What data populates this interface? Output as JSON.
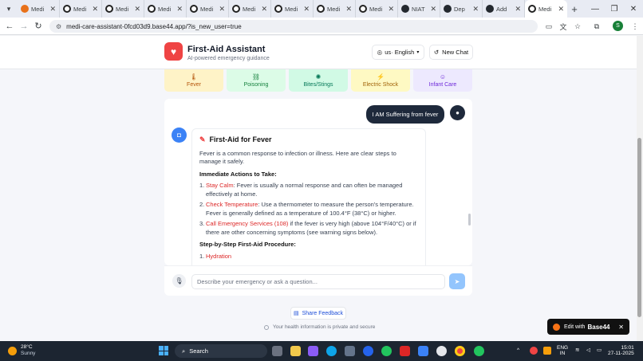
{
  "browser": {
    "tabs": [
      {
        "label": "Medi",
        "icon": "red",
        "active": false
      },
      {
        "label": "Medi",
        "icon": "white",
        "active": false
      },
      {
        "label": "Medi",
        "icon": "white",
        "active": false
      },
      {
        "label": "Medi",
        "icon": "white",
        "active": false
      },
      {
        "label": "Medi",
        "icon": "white",
        "active": false
      },
      {
        "label": "Medi",
        "icon": "white",
        "active": false
      },
      {
        "label": "Medi",
        "icon": "white",
        "active": false
      },
      {
        "label": "Medi",
        "icon": "white",
        "active": false
      },
      {
        "label": "Medi",
        "icon": "white",
        "active": false
      },
      {
        "label": "NIAT",
        "icon": "github",
        "active": false
      },
      {
        "label": "Dep",
        "icon": "github",
        "active": false
      },
      {
        "label": "Add",
        "icon": "github",
        "active": false
      },
      {
        "label": "Medi",
        "icon": "white",
        "active": true
      }
    ],
    "url": "medi-care-assistant-0fcd03d9.base44.app/?is_new_user=true",
    "profile_initial": "S"
  },
  "app": {
    "title": "First-Aid Assistant",
    "subtitle": "AI-powered emergency guidance",
    "language": "us· English",
    "new_chat": "New Chat",
    "accent": "#ef4444"
  },
  "categories": [
    {
      "label": "Fever",
      "icon": "thermometer-icon",
      "bg": "#fef3c7",
      "fg": "#b45309"
    },
    {
      "label": "Poisoning",
      "icon": "link-icon",
      "bg": "#dcfce7",
      "fg": "#15803d"
    },
    {
      "label": "Bites/Stings",
      "icon": "bug-icon",
      "bg": "#d1fae5",
      "fg": "#047857"
    },
    {
      "label": "Electric Shock",
      "icon": "bolt-icon",
      "bg": "#fef9c3",
      "fg": "#a16207"
    },
    {
      "label": "Infant Care",
      "icon": "baby-icon",
      "bg": "#ede9fe",
      "fg": "#6d28d9"
    }
  ],
  "chat": {
    "user_message": "I AM Suffering from fever",
    "bot": {
      "title": "First-Aid for Fever",
      "intro": "Fever is a common response to infection or illness. Here are clear steps to manage it safely.",
      "immediate_heading": "Immediate Actions to Take:",
      "immediate": [
        {
          "n": "1.",
          "key": "Stay Calm",
          "text": ": Fever is usually a normal response and can often be managed effectively at home."
        },
        {
          "n": "2.",
          "key": "Check Temperature",
          "text": ": Use a thermometer to measure the person's temperature. Fever is generally defined as a temperature of 100.4°F (38°C) or higher."
        },
        {
          "n": "3.",
          "key": "Call Emergency Services (108)",
          "text": " if the fever is very high (above 104°F/40°C) or if there are other concerning symptoms (see warning signs below)."
        }
      ],
      "procedure_heading": "Step-by-Step First-Aid Procedure:",
      "procedure": [
        {
          "n": "1.",
          "key": "Hydration",
          "text": ""
        }
      ]
    }
  },
  "composer": {
    "placeholder": "Describe your emergency or ask a question..."
  },
  "footer": {
    "feedback": "Share Feedback",
    "privacy": "Your health information is private and secure"
  },
  "badge": {
    "edit_with": "Edit with",
    "brand": "Base44"
  },
  "taskbar": {
    "temp": "28°C",
    "weather": "Sunny",
    "search": "Search",
    "lang_top": "ENG",
    "lang_bottom": "IN",
    "time": "15:01",
    "date": "27-11-2025"
  }
}
